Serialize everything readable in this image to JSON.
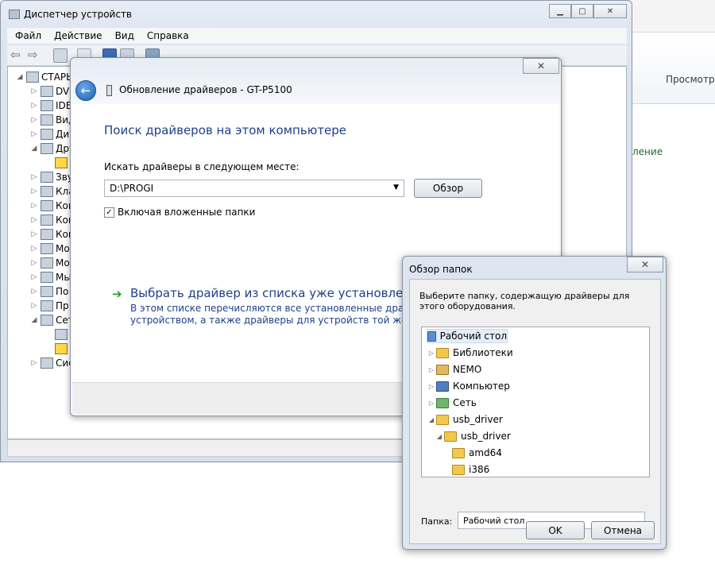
{
  "background": {
    "view_label": "Просмотр:",
    "link_fragment": "ление"
  },
  "device_manager": {
    "title": "Диспетчер устройств",
    "menu": [
      "Файл",
      "Действие",
      "Вид",
      "Справка"
    ],
    "tree": [
      {
        "label": "СТАРЬ",
        "expanded": true
      },
      {
        "label": "DV"
      },
      {
        "label": "IDE"
      },
      {
        "label": "Вид"
      },
      {
        "label": "Ди"
      },
      {
        "label": "Дру",
        "expanded": true
      },
      {
        "label": ""
      },
      {
        "label": "Зву"
      },
      {
        "label": "Кла"
      },
      {
        "label": "Ком"
      },
      {
        "label": "Ком"
      },
      {
        "label": "Ком"
      },
      {
        "label": "Мо"
      },
      {
        "label": "Мо"
      },
      {
        "label": "Мы"
      },
      {
        "label": "По"
      },
      {
        "label": "Пр"
      },
      {
        "label": "Сет",
        "expanded": true
      },
      {
        "label": ""
      },
      {
        "label": ""
      },
      {
        "label": "Сис"
      }
    ]
  },
  "update_driver": {
    "title": "Обновление драйверов - GT-P5100",
    "close_glyph": "✕",
    "heading": "Поиск драйверов на этом компьютере",
    "search_label": "Искать драйверы в следующем месте:",
    "path_value": "D:\\PROGI",
    "browse_button": "Обзор",
    "include_subfolders": "Включая вложенные папки",
    "include_checked": true,
    "pick_link": "Выбрать драйвер из списка уже установленных",
    "pick_desc_1": "В этом списке перечисляются все установленные драйверы, с",
    "pick_desc_2": "устройством, а также драйверы для устройств той же категори"
  },
  "browse_folder": {
    "title": "Обзор папок",
    "close_glyph": "✕",
    "description": "Выберите папку, содержащую драйверы для этого оборудования.",
    "tree": [
      {
        "label": "Рабочий стол",
        "icon": "desktop-icon",
        "selected": true
      },
      {
        "label": "Библиотеки",
        "icon": "library-icon"
      },
      {
        "label": "NEMO",
        "icon": "user-folder-icon"
      },
      {
        "label": "Компьютер",
        "icon": "computer-icon"
      },
      {
        "label": "Сеть",
        "icon": "network-icon"
      },
      {
        "label": "usb_driver",
        "icon": "folder-icon",
        "expanded": true
      },
      {
        "label": "usb_driver",
        "icon": "folder-icon",
        "expanded": true
      },
      {
        "label": "amd64",
        "icon": "folder-icon"
      },
      {
        "label": "i386",
        "icon": "folder-icon"
      }
    ],
    "folder_label": "Папка:",
    "folder_value": "Рабочий стол",
    "ok_button": "OK",
    "cancel_button": "Отмена"
  }
}
